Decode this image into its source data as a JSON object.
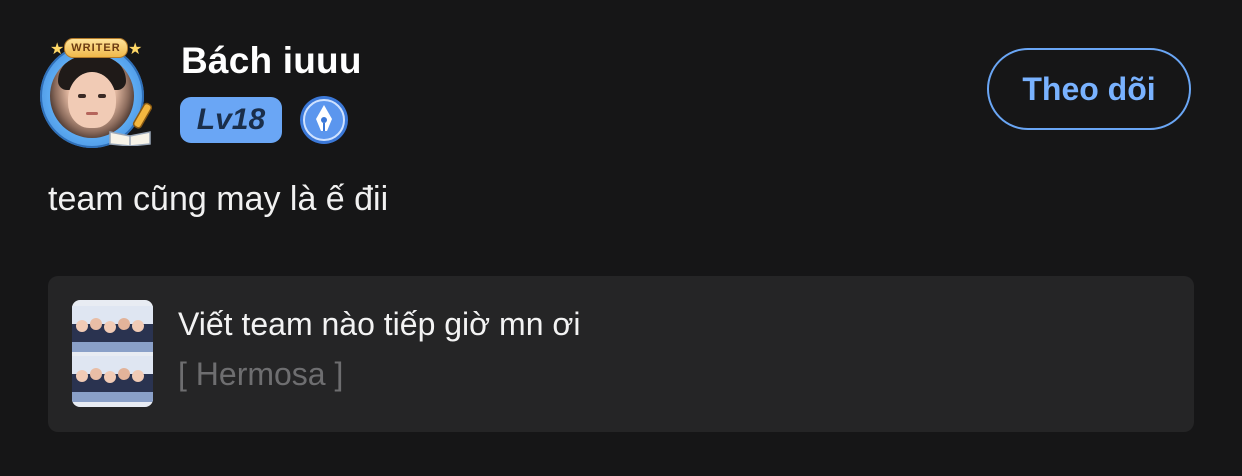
{
  "user": {
    "name": "Bách iuuu",
    "level_label": "Lv18",
    "avatar_badge_text": "WRITER"
  },
  "follow_button": {
    "label": "Theo dõi"
  },
  "post": {
    "text": "team cũng may là ế đii"
  },
  "linked_card": {
    "title": "Viết team nào tiếp giờ mn ơi",
    "subtitle": "[ Hermosa ]"
  },
  "colors": {
    "background": "#161617",
    "accent": "#6aa6f5",
    "card": "#252526",
    "muted_text": "#6e6e70"
  },
  "icons": [
    "writer-frame-icon",
    "pen-icon",
    "book-icon",
    "star-icon",
    "writer-level-icon"
  ]
}
